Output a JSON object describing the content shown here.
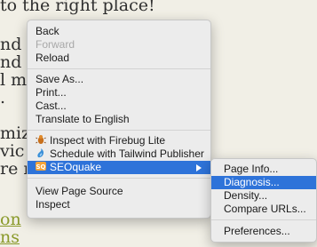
{
  "background": {
    "lines": [
      "to the right place!",
      "nd",
      "nd",
      "l m",
      ".",
      "miz",
      "vic",
      "re r"
    ],
    "link_lines": [
      "on",
      "ns"
    ]
  },
  "menu": {
    "items": [
      {
        "label": "Back"
      },
      {
        "label": "Forward",
        "disabled": true
      },
      {
        "label": "Reload"
      },
      {
        "label": "Save As..."
      },
      {
        "label": "Print..."
      },
      {
        "label": "Cast..."
      },
      {
        "label": "Translate to English"
      },
      {
        "label": "Inspect with Firebug Lite",
        "icon": "firebug-icon"
      },
      {
        "label": "Schedule with Tailwind Publisher",
        "icon": "tailwind-icon"
      },
      {
        "label": "SEOquake",
        "icon": "seoquake-icon",
        "selected": true,
        "has_submenu": true
      },
      {
        "label": "View Page Source"
      },
      {
        "label": "Inspect"
      }
    ]
  },
  "submenu": {
    "items": [
      {
        "label": "Page Info..."
      },
      {
        "label": "Diagnosis...",
        "selected": true
      },
      {
        "label": "Density..."
      },
      {
        "label": "Compare URLs..."
      },
      {
        "label": "Preferences..."
      }
    ]
  },
  "colors": {
    "selection": "#2e73d9",
    "menu_bg": "#ececec",
    "link": "#8a9a2a"
  }
}
